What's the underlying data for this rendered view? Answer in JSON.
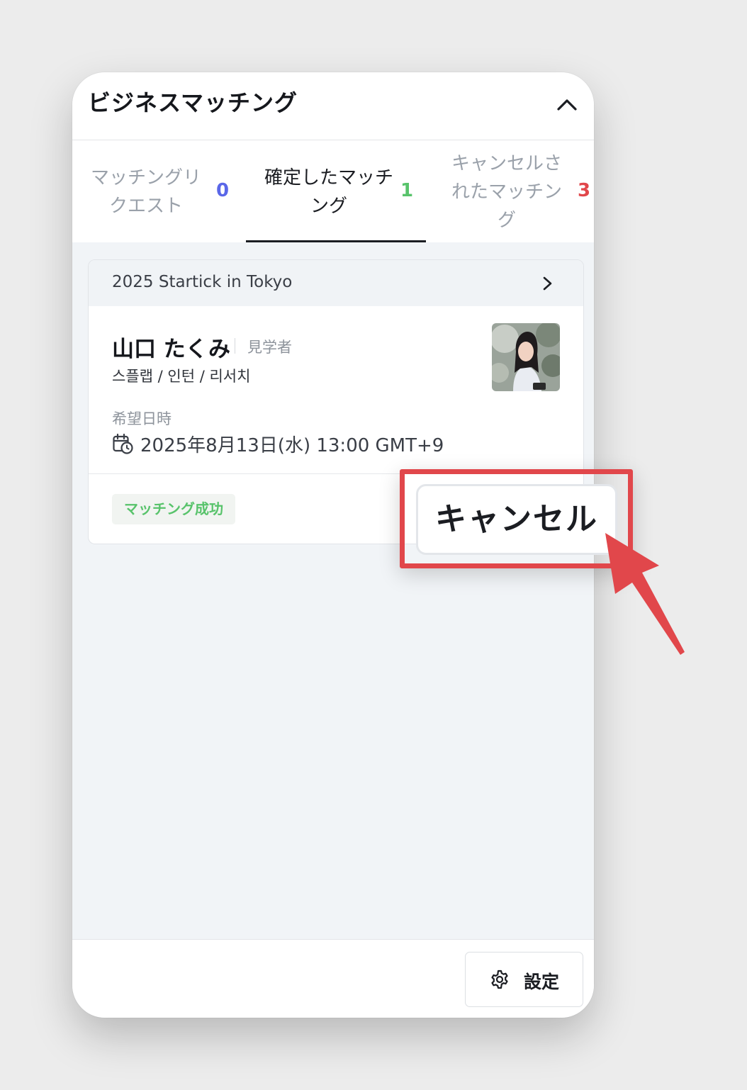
{
  "header": {
    "title": "ビジネスマッチング"
  },
  "tabs": [
    {
      "label_lines": [
        "マッチングリ",
        "クエスト"
      ],
      "count": "0",
      "count_color": "#5a67e8",
      "active": false
    },
    {
      "label_lines": [
        "確定したマッチ",
        "ング"
      ],
      "count": "1",
      "count_color": "#58c36b",
      "active": true
    },
    {
      "label_lines": [
        "キャンセルさ",
        "れたマッチン",
        "グ"
      ],
      "count": "3",
      "count_color": "#e1474b",
      "active": false
    }
  ],
  "card": {
    "event_name": "2025 Startick in Tokyo",
    "person_name": "山口 たくみ",
    "person_role": "見学者",
    "person_tags": "스플랩 / 인턴 / 리서치",
    "date_label": "希望日時",
    "date_value": "2025年8月13日(水) 13:00 GMT+9",
    "status": "マッチング成功",
    "status_color": "#58c36b"
  },
  "callout": {
    "cancel_label": "キャンセル",
    "highlight_color": "#e1474b"
  },
  "footer": {
    "settings_label": "設定"
  },
  "icons": {
    "collapse": "chevron-up-icon",
    "event": "chevron-right-icon",
    "date": "calendar-clock-icon",
    "settings": "gear-icon"
  }
}
